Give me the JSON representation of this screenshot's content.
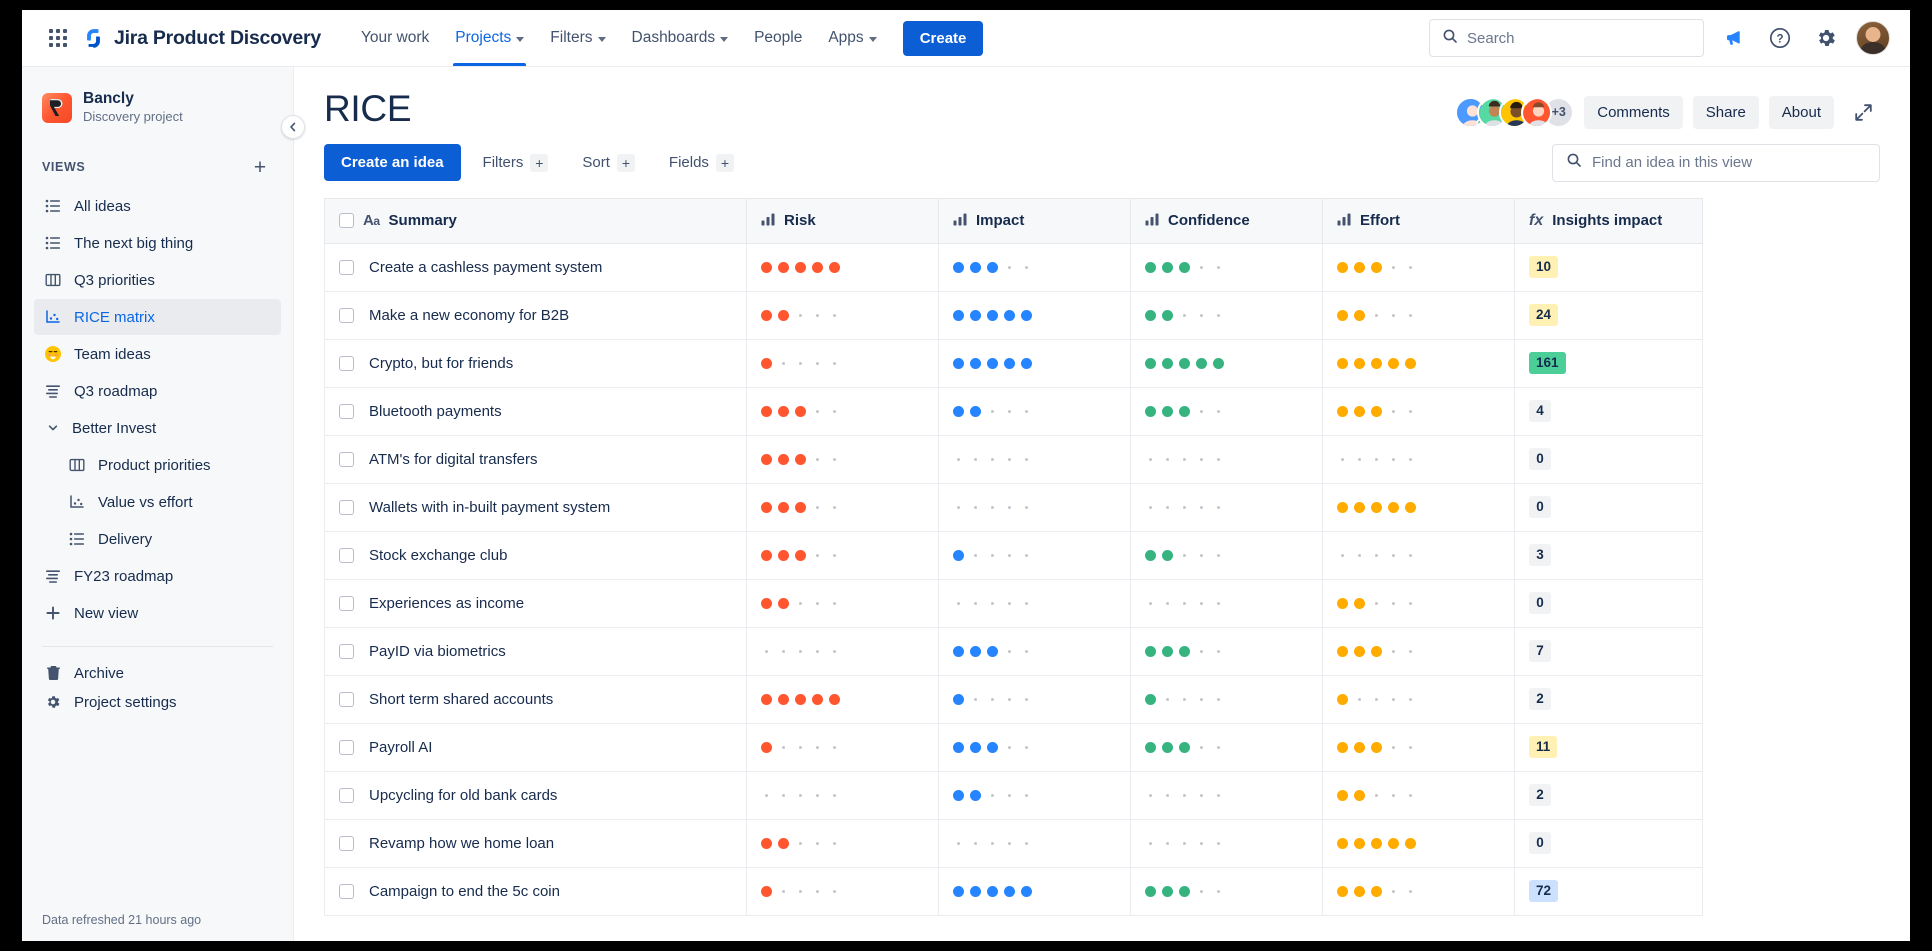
{
  "topnav": {
    "app_switcher_icon": "grid-icon",
    "brand": "Jira Product Discovery",
    "items": [
      {
        "label": "Your work",
        "has_caret": false,
        "active": false
      },
      {
        "label": "Projects",
        "has_caret": true,
        "active": true
      },
      {
        "label": "Filters",
        "has_caret": true,
        "active": false
      },
      {
        "label": "Dashboards",
        "has_caret": true,
        "active": false
      },
      {
        "label": "People",
        "has_caret": false,
        "active": false
      },
      {
        "label": "Apps",
        "has_caret": true,
        "active": false
      }
    ],
    "create_label": "Create",
    "search_placeholder": "Search",
    "search_value": "",
    "icons": [
      "megaphone-icon",
      "help-icon",
      "gear-icon",
      "avatar"
    ]
  },
  "sidebar": {
    "project_name": "Bancly",
    "project_subtitle": "Discovery project",
    "views_heading": "VIEWS",
    "add_view_label": "+",
    "views": [
      {
        "label": "All ideas",
        "icon": "list-icon",
        "selected": false,
        "nested": false
      },
      {
        "label": "The next big thing",
        "icon": "list-icon",
        "selected": false,
        "nested": false
      },
      {
        "label": "Q3 priorities",
        "icon": "board-icon",
        "selected": false,
        "nested": false
      },
      {
        "label": "RICE matrix",
        "icon": "matrix-icon",
        "selected": true,
        "nested": false
      },
      {
        "label": "Team ideas",
        "icon": "emoji-icon",
        "selected": false,
        "nested": false
      },
      {
        "label": "Q3 roadmap",
        "icon": "timeline-icon",
        "selected": false,
        "nested": false
      },
      {
        "label": "Better Invest",
        "icon": "chevron-down-icon",
        "selected": false,
        "nested": false,
        "group": true
      },
      {
        "label": "Product priorities",
        "icon": "board-icon",
        "selected": false,
        "nested": true
      },
      {
        "label": "Value vs effort",
        "icon": "matrix-icon",
        "selected": false,
        "nested": true
      },
      {
        "label": "Delivery",
        "icon": "list-icon",
        "selected": false,
        "nested": true
      },
      {
        "label": "FY23 roadmap",
        "icon": "timeline-icon",
        "selected": false,
        "nested": false
      },
      {
        "label": "New view",
        "icon": "plus-icon",
        "selected": false,
        "nested": false
      }
    ],
    "bottom_items": [
      {
        "label": "Archive",
        "icon": "trash-icon"
      },
      {
        "label": "Project settings",
        "icon": "gear-icon"
      }
    ],
    "footer_text": "Data refreshed 21 hours ago",
    "collapse_icon": "chevron-left-icon"
  },
  "main": {
    "title": "RICE",
    "avatar_overflow": "+3",
    "header_buttons": [
      "Comments",
      "Share",
      "About"
    ],
    "expand_icon": "expand-icon",
    "toolbar": {
      "create_idea_label": "Create an idea",
      "filters_label": "Filters",
      "sort_label": "Sort",
      "fields_label": "Fields",
      "plus_glyph": "+",
      "find_placeholder": "Find an idea in this view",
      "find_value": ""
    }
  },
  "table": {
    "columns": [
      {
        "label": "Summary",
        "icon": "text-field-icon"
      },
      {
        "label": "Risk",
        "icon": "rating-bars-icon"
      },
      {
        "label": "Impact",
        "icon": "rating-bars-icon"
      },
      {
        "label": "Confidence",
        "icon": "rating-bars-icon"
      },
      {
        "label": "Effort",
        "icon": "rating-bars-icon"
      },
      {
        "label": "Insights impact",
        "icon": "formula-icon"
      }
    ],
    "max_dots": 5,
    "colors": {
      "risk": "#ff5630",
      "impact": "#2684ff",
      "confidence": "#36b37e",
      "effort": "#ffab00",
      "dot_off": "#c1c7d0",
      "badge_yellow_bg": "#fff0b3",
      "badge_green_bg": "#4bce97",
      "badge_blue_bg": "#cce0ff",
      "badge_grey_bg": "#f1f2f4",
      "accent_blue": "#0c66e4"
    },
    "rows": [
      {
        "summary": "Create a cashless payment system",
        "risk": 5,
        "impact": 3,
        "confidence": 3,
        "effort": 3,
        "insights": "10",
        "badge": "yellow"
      },
      {
        "summary": "Make a new economy for B2B",
        "risk": 2,
        "impact": 5,
        "confidence": 2,
        "effort": 2,
        "insights": "24",
        "badge": "yellow"
      },
      {
        "summary": "Crypto, but for friends",
        "risk": 1,
        "impact": 5,
        "confidence": 5,
        "effort": 5,
        "insights": "161",
        "badge": "green"
      },
      {
        "summary": "Bluetooth payments",
        "risk": 3,
        "impact": 2,
        "confidence": 3,
        "effort": 3,
        "insights": "4",
        "badge": "grey"
      },
      {
        "summary": "ATM's for digital transfers",
        "risk": 3,
        "impact": 0,
        "confidence": 0,
        "effort": 0,
        "insights": "0",
        "badge": "grey"
      },
      {
        "summary": "Wallets with in-built payment system",
        "risk": 3,
        "impact": 0,
        "confidence": 0,
        "effort": 5,
        "insights": "0",
        "badge": "grey"
      },
      {
        "summary": "Stock exchange club",
        "risk": 3,
        "impact": 1,
        "confidence": 2,
        "effort": 0,
        "insights": "3",
        "badge": "grey"
      },
      {
        "summary": "Experiences as income",
        "risk": 2,
        "impact": 0,
        "confidence": 0,
        "effort": 2,
        "insights": "0",
        "badge": "grey"
      },
      {
        "summary": "PayID via biometrics",
        "risk": 0,
        "impact": 3,
        "confidence": 3,
        "effort": 3,
        "insights": "7",
        "badge": "grey"
      },
      {
        "summary": "Short term shared accounts",
        "risk": 5,
        "impact": 1,
        "confidence": 1,
        "effort": 1,
        "insights": "2",
        "badge": "grey"
      },
      {
        "summary": "Payroll AI",
        "risk": 1,
        "impact": 3,
        "confidence": 3,
        "effort": 3,
        "insights": "11",
        "badge": "yellow"
      },
      {
        "summary": "Upcycling for old bank cards",
        "risk": 0,
        "impact": 2,
        "confidence": 0,
        "effort": 2,
        "insights": "2",
        "badge": "grey"
      },
      {
        "summary": "Revamp how we home loan",
        "risk": 2,
        "impact": 0,
        "confidence": 0,
        "effort": 5,
        "insights": "0",
        "badge": "grey"
      },
      {
        "summary": "Campaign to end the 5c coin",
        "risk": 1,
        "impact": 5,
        "confidence": 3,
        "effort": 3,
        "insights": "72",
        "badge": "blue"
      }
    ]
  }
}
